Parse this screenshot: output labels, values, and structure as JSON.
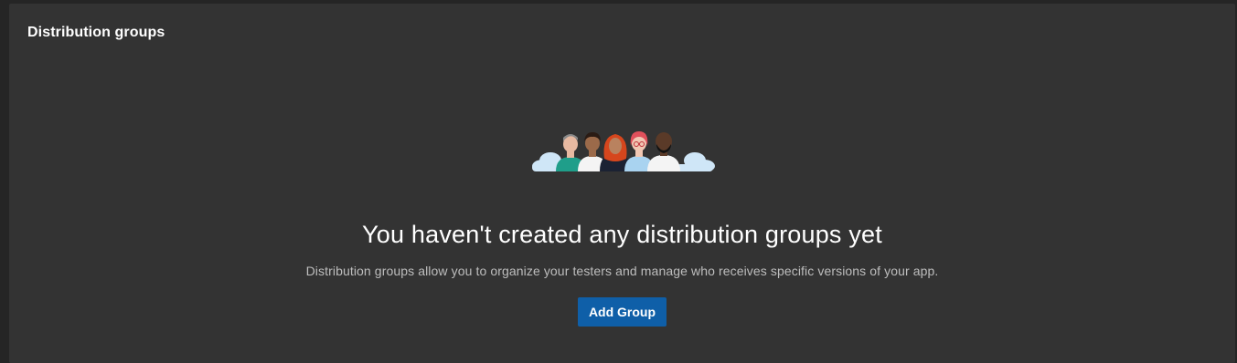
{
  "panel": {
    "title": "Distribution groups"
  },
  "empty_state": {
    "illustration": "people-group-illustration",
    "headline": "You haven't created any distribution groups yet",
    "description": "Distribution groups allow you to organize your testers and manage who receives specific versions of your app.",
    "add_button_label": "Add Group"
  },
  "colors": {
    "page_background": "#252525",
    "panel_background": "#333333",
    "primary_button": "#0f5fa8",
    "cloud": "#cfe6f7"
  }
}
